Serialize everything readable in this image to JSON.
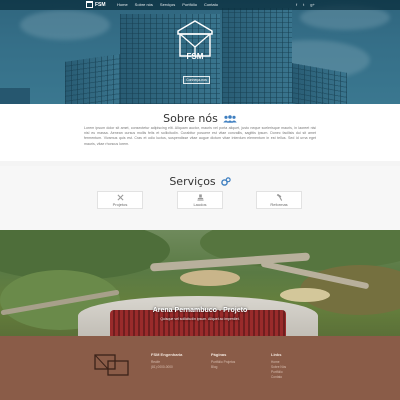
{
  "nav": {
    "brand": "FSM",
    "menu": [
      "Home",
      "Sobre nós",
      "Serviços",
      "Portfólio",
      "Contato"
    ],
    "social": [
      "f",
      "t",
      "g+"
    ]
  },
  "hero": {
    "logo_text": "FSM",
    "button_label": "Conheça-nos"
  },
  "about": {
    "title": "Sobre nós",
    "icon": "users-icon",
    "text": "Lorem ipsum dolor sit amet, consectetur adipiscing elit. Aliquam auctor, mauris vel porta aliquet, justo neque scelerisque mauris, in laoreet nisi nisl eu massa. Aenean cursus mollis felis et sollicitudin. Curabitur posuere est vitae convallis, sagittis ipsum. Donec facilisis dui sit amet fermentum. Vivamus quis est. Cras et odio luctus, suspendisse vitae augue dictum vitae interdum elementum in est tellus. Sed id urna eget mauris, vitae rhoncus lorem."
  },
  "services": {
    "title": "Serviços",
    "icon": "gears-icon",
    "items": [
      {
        "label": "Projetos",
        "icon": "tools-icon"
      },
      {
        "label": "Laudos",
        "icon": "stamp-icon"
      },
      {
        "label": "Reformas",
        "icon": "hammer-icon"
      }
    ]
  },
  "portfolio": {
    "caption": "Arena Pernambuco - Projeto",
    "subcaption": "Quisque vel sollicitudin ipsum. Aliquet ac imperdiet."
  },
  "footer": {
    "columns": [
      {
        "heading": "FSM Engenharia",
        "lines": [
          "Recife",
          "(81) 0000-0000"
        ]
      },
      {
        "heading": "Páginas",
        "lines": [
          "Portfólio Projetos",
          "Blog"
        ]
      },
      {
        "heading": "Links",
        "lines": [
          "Home",
          "Sobre Nós",
          "Portfólio",
          "Contato"
        ]
      }
    ]
  },
  "colors": {
    "nav_bg": "#0a2d3c",
    "hero_tint": "#427c96",
    "footer_bg": "#8a5c48",
    "accent": "#3f7fc0"
  }
}
